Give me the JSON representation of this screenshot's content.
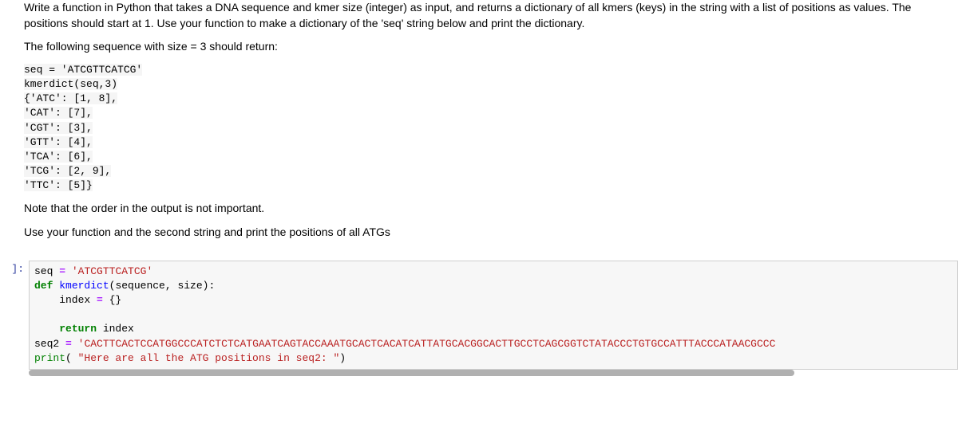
{
  "markdown": {
    "p1": "Write a function in Python that takes a DNA sequence and kmer size (integer) as input, and returns a dictionary of all kmers (keys) in the string with a list of positions as values. The positions should start at 1. Use your function to make a dictionary of the 'seq' string below and print the dictionary.",
    "p2": "The following sequence with size = 3 should return:",
    "ex1": "seq = 'ATCGTTCATCG'",
    "ex2": "kmerdict(seq,3)",
    "ex3": "{'ATC': [1, 8],",
    "ex4": "'CAT': [7],",
    "ex5": "'CGT': [3],",
    "ex6": "'GTT': [4],",
    "ex7": "'TCA': [6],",
    "ex8": "'TCG': [2, 9],",
    "ex9": "'TTC': [5]}",
    "p3": "Note that the order in the output is not important.",
    "p4": "Use your function and the second string and print the positions of all ATGs"
  },
  "prompt": "]:",
  "code": {
    "l1a": "seq ",
    "l1b": "=",
    "l1c": " ",
    "l1d": "'ATCGTTCATCG'",
    "l2a": "def",
    "l2b": " ",
    "l2c": "kmerdict",
    "l2d": "(sequence, size):",
    "l3": "    index ",
    "l3b": "=",
    "l3c": " {}",
    "l4": "    ",
    "l5a": "    ",
    "l5b": "return",
    "l5c": " index",
    "l6a": "seq2 ",
    "l6b": "=",
    "l6c": " ",
    "l6d": "'CACTTCACTCCATGGCCCATCTCTCATGAATCAGTACCAAATGCACTCACATCATTATGCACGGCACTTGCCTCAGCGGTCTATACCCTGTGCCATTTACCCATAACGCCC",
    "l7a": "print",
    "l7b": "( ",
    "l7c": "\"Here are all the ATG positions in seq2: \"",
    "l7d": ")"
  }
}
